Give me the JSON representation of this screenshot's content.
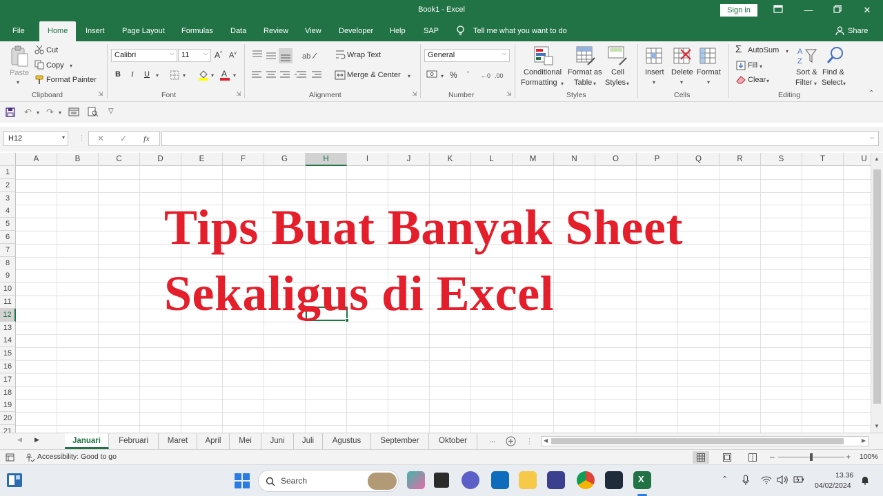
{
  "window": {
    "title": "Book1  -  Excel",
    "signin_label": "Sign in"
  },
  "menu_tabs": [
    {
      "label": "File"
    },
    {
      "label": "Home"
    },
    {
      "label": "Insert"
    },
    {
      "label": "Page Layout"
    },
    {
      "label": "Formulas"
    },
    {
      "label": "Data"
    },
    {
      "label": "Review"
    },
    {
      "label": "View"
    },
    {
      "label": "Developer"
    },
    {
      "label": "Help"
    },
    {
      "label": "SAP"
    }
  ],
  "tell_me": "Tell me what you want to do",
  "share_label": "Share",
  "ribbon": {
    "clipboard": {
      "paste": "Paste",
      "cut": "Cut",
      "copy": "Copy",
      "format_painter": "Format Painter",
      "group": "Clipboard"
    },
    "font": {
      "name": "Calibri",
      "size": "11",
      "bold": "B",
      "italic": "I",
      "underline": "U",
      "group": "Font"
    },
    "alignment": {
      "wrap_text": "Wrap Text",
      "merge_center": "Merge & Center",
      "group": "Alignment"
    },
    "number": {
      "format": "General",
      "percent": "%",
      "comma": "’",
      "group": "Number"
    },
    "styles": {
      "conditional_1": "Conditional",
      "conditional_2": "Formatting",
      "format_table_1": "Format as",
      "format_table_2": "Table",
      "cell_styles_1": "Cell",
      "cell_styles_2": "Styles",
      "group": "Styles"
    },
    "cells": {
      "insert": "Insert",
      "delete": "Delete",
      "format": "Format",
      "group": "Cells"
    },
    "editing": {
      "autosum": "AutoSum",
      "fill": "Fill",
      "clear": "Clear",
      "sort_1": "Sort &",
      "sort_2": "Filter",
      "find_1": "Find &",
      "find_2": "Select",
      "group": "Editing"
    }
  },
  "formula_bar": {
    "name_box": "H12",
    "fx": "fx",
    "value": ""
  },
  "columns": [
    "A",
    "B",
    "C",
    "D",
    "E",
    "F",
    "G",
    "H",
    "I",
    "J",
    "K",
    "L",
    "M",
    "N",
    "O",
    "P",
    "Q",
    "R",
    "S",
    "T",
    "U"
  ],
  "rows": [
    "1",
    "2",
    "3",
    "4",
    "5",
    "6",
    "7",
    "8",
    "9",
    "10",
    "11",
    "12",
    "13",
    "14",
    "15",
    "16",
    "17",
    "18",
    "19",
    "20",
    "21"
  ],
  "selected_cell": {
    "column": "H",
    "row": "12"
  },
  "overlay_text": {
    "line1": "Tips Buat Banyak Sheet",
    "line2": "Sekaligus di Excel"
  },
  "sheets": [
    {
      "label": "Januari",
      "active": true
    },
    {
      "label": "Februari"
    },
    {
      "label": "Maret"
    },
    {
      "label": "April"
    },
    {
      "label": "Mei"
    },
    {
      "label": "Juni"
    },
    {
      "label": "Juli"
    },
    {
      "label": "Agustus"
    },
    {
      "label": "September"
    },
    {
      "label": "Oktober"
    }
  ],
  "sheet_more": "...",
  "status": {
    "accessibility": "Accessibility: Good to go",
    "zoom": "100%"
  },
  "taskbar": {
    "search_placeholder": "Search",
    "time": "13.36",
    "date": "04/02/2024"
  },
  "colors": {
    "excel_green": "#217346",
    "overlay_red": "#e41e2a"
  }
}
